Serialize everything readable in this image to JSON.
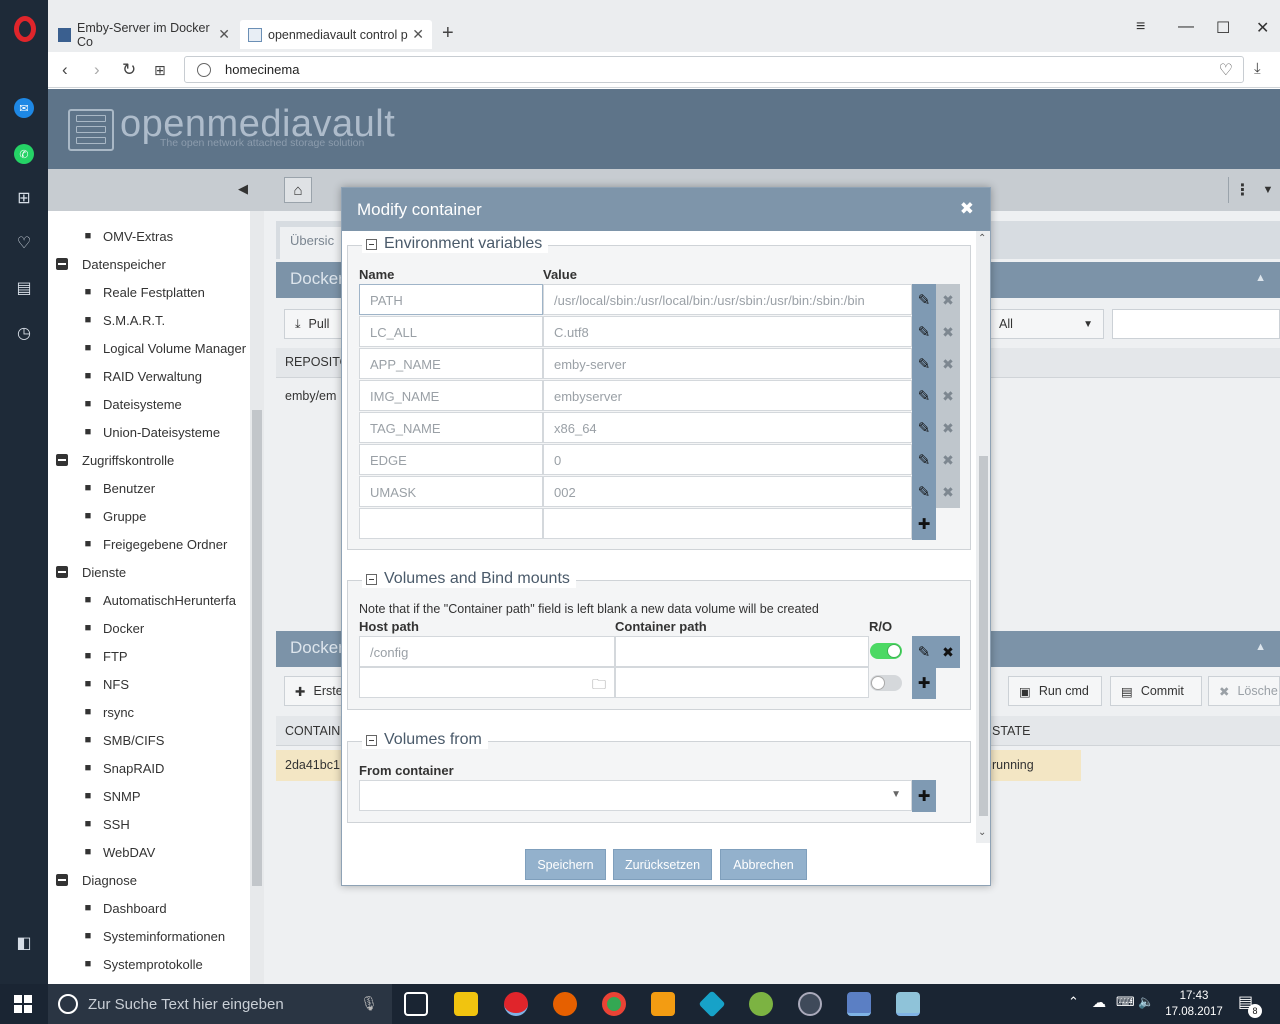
{
  "browser": {
    "tabs": [
      {
        "label": "Emby-Server im Docker Co",
        "active": false
      },
      {
        "label": "openmediavault control p",
        "active": true
      }
    ],
    "url": "homecinema"
  },
  "omv": {
    "logo_text": "openmediavault",
    "logo_sub": "The open network attached storage solution",
    "toolbar_tabs": [
      "Übersic"
    ],
    "panel1_title": "Docker",
    "panel2_title": "Docker",
    "pull_label": "Pull",
    "filter_all": "All",
    "col_repository": "REPOSITO",
    "row_repo": "emby/em",
    "create_label": "Erste",
    "run_cmd": "Run cmd",
    "commit": "Commit",
    "delete": "Lösche",
    "col_container": "CONTAIN",
    "col_state": "STATE",
    "row_container": "2da41bc1",
    "row_state": "running"
  },
  "nav": {
    "items": [
      {
        "label": "OMV-Extras",
        "type": "item",
        "icon": "plug-icon"
      },
      {
        "label": "Datenspeicher",
        "type": "cat"
      },
      {
        "label": "Reale Festplatten",
        "type": "item",
        "icon": "disk-icon"
      },
      {
        "label": "S.M.A.R.T.",
        "type": "item",
        "icon": "chart-icon"
      },
      {
        "label": "Logical Volume Manager",
        "type": "item",
        "icon": "database-icon"
      },
      {
        "label": "RAID Verwaltung",
        "type": "item",
        "icon": "raid-icon"
      },
      {
        "label": "Dateisysteme",
        "type": "item",
        "icon": "folder-icon"
      },
      {
        "label": "Union-Dateisysteme",
        "type": "item",
        "icon": "sitemap-icon"
      },
      {
        "label": "Zugriffskontrolle",
        "type": "cat"
      },
      {
        "label": "Benutzer",
        "type": "item",
        "icon": "user-icon"
      },
      {
        "label": "Gruppe",
        "type": "item",
        "icon": "users-icon"
      },
      {
        "label": "Freigegebene Ordner",
        "type": "item",
        "icon": "share-icon"
      },
      {
        "label": "Dienste",
        "type": "cat"
      },
      {
        "label": "AutomatischHerunterfa",
        "type": "item",
        "icon": "power-icon"
      },
      {
        "label": "Docker",
        "type": "item",
        "icon": "docker-icon"
      },
      {
        "label": "FTP",
        "type": "item",
        "icon": "ftp-icon"
      },
      {
        "label": "NFS",
        "type": "item",
        "icon": "file-icon"
      },
      {
        "label": "rsync",
        "type": "item",
        "icon": "sync-icon"
      },
      {
        "label": "SMB/CIFS",
        "type": "item",
        "icon": "windows-icon"
      },
      {
        "label": "SnapRAID",
        "type": "item",
        "icon": "grid-icon"
      },
      {
        "label": "SNMP",
        "type": "item",
        "icon": "network-icon"
      },
      {
        "label": "SSH",
        "type": "item",
        "icon": "terminal-icon"
      },
      {
        "label": "WebDAV",
        "type": "item",
        "icon": "globe-icon"
      },
      {
        "label": "Diagnose",
        "type": "cat"
      },
      {
        "label": "Dashboard",
        "type": "item",
        "icon": "dashboard-icon"
      },
      {
        "label": "Systeminformationen",
        "type": "item",
        "icon": "line-chart-icon"
      },
      {
        "label": "Systemprotokolle",
        "type": "item",
        "icon": "log-icon"
      }
    ]
  },
  "modal": {
    "title": "Modify container",
    "env": {
      "legend": "Environment variables",
      "col_name": "Name",
      "col_value": "Value",
      "rows": [
        {
          "name": "PATH",
          "value": "/usr/local/sbin:/usr/local/bin:/usr/sbin:/usr/bin:/sbin:/bin"
        },
        {
          "name": "LC_ALL",
          "value": "C.utf8"
        },
        {
          "name": "APP_NAME",
          "value": "emby-server"
        },
        {
          "name": "IMG_NAME",
          "value": "embyserver"
        },
        {
          "name": "TAG_NAME",
          "value": "x86_64"
        },
        {
          "name": "EDGE",
          "value": "0"
        },
        {
          "name": "UMASK",
          "value": "002"
        }
      ]
    },
    "volumes": {
      "legend": "Volumes and Bind mounts",
      "note": "Note that if the \"Container path\" field is left blank a new data volume will be created",
      "col_host": "Host path",
      "col_container": "Container path",
      "col_ro": "R/O",
      "rows": [
        {
          "host": "/config",
          "container": "",
          "ro": true
        }
      ]
    },
    "volumes_from": {
      "legend": "Volumes from",
      "label": "From container"
    },
    "buttons": {
      "save": "Speichern",
      "reset": "Zurücksetzen",
      "cancel": "Abbrechen"
    }
  },
  "taskbar": {
    "search_placeholder": "Zur Suche Text hier eingeben",
    "time": "17:43",
    "date": "17.08.2017",
    "notif_count": "8"
  },
  "colors": {
    "accent": "#7e95aa",
    "toggle_on": "#4cd964",
    "running_row": "#f3e6c4"
  }
}
